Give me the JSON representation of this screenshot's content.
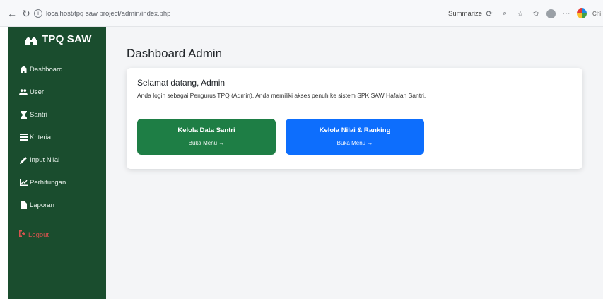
{
  "browser": {
    "url": "localhost/tpq saw project/admin/index.php",
    "summarize_label": "Summarize",
    "more_label": "···",
    "profile_label": "Chi"
  },
  "sidebar": {
    "brand": "TPQ SAW",
    "items": [
      {
        "label": "Dashboard",
        "icon": "home-icon"
      },
      {
        "label": "User",
        "icon": "users-icon"
      },
      {
        "label": "Santri",
        "icon": "hourglass-icon"
      },
      {
        "label": "Kriteria",
        "icon": "list-icon"
      },
      {
        "label": "Input Nilai",
        "icon": "pencil-icon"
      },
      {
        "label": "Perhitungan",
        "icon": "chart-icon"
      },
      {
        "label": "Laporan",
        "icon": "file-icon"
      }
    ],
    "logout": "Logout"
  },
  "main": {
    "title": "Dashboard Admin",
    "welcome": "Selamat datang, Admin",
    "subtitle": "Anda login sebagai Pengurus TPQ (Admin). Anda memiliki akses penuh ke sistem SPK SAW Hafalan Santri.",
    "tiles": [
      {
        "title": "Kelola Data Santri",
        "sub": "Buka Menu →",
        "color": "#1e7e45"
      },
      {
        "title": "Kelola Nilai & Ranking",
        "sub": "Buka Menu →",
        "color": "#0d6efd"
      }
    ]
  },
  "colors": {
    "sidebar": "#1a4d2e",
    "logout": "#d9534f",
    "background": "#f4f5f7"
  }
}
